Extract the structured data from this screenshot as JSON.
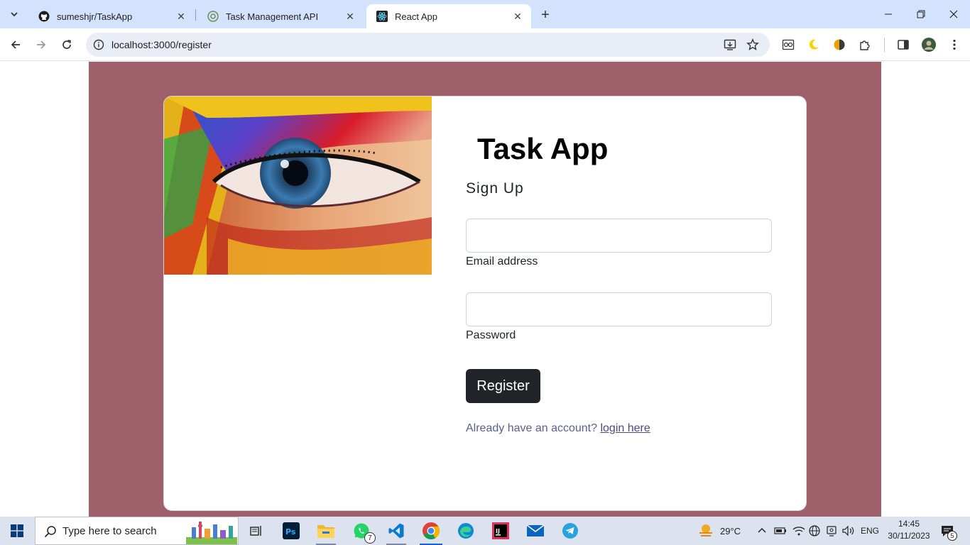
{
  "browser": {
    "tabs": [
      {
        "title": "sumeshjr/TaskApp",
        "icon": "github-icon"
      },
      {
        "title": "Task Management API",
        "icon": "swagger-icon"
      },
      {
        "title": "React App",
        "icon": "react-icon"
      }
    ],
    "url": "localhost:3000/register"
  },
  "page": {
    "background_color": "#9e606b",
    "title": "Task App",
    "subtitle": "Sign Up",
    "email": {
      "label": "Email address",
      "value": ""
    },
    "password": {
      "label": "Password",
      "value": ""
    },
    "register_label": "Register",
    "already_text": "Already have an account?",
    "login_link": "login here"
  },
  "taskbar": {
    "search_placeholder": "Type here to search",
    "whatsapp_badge": "7",
    "temperature": "29°C",
    "language": "ENG",
    "time": "14:45",
    "date": "30/11/2023",
    "notification_count": "5"
  }
}
